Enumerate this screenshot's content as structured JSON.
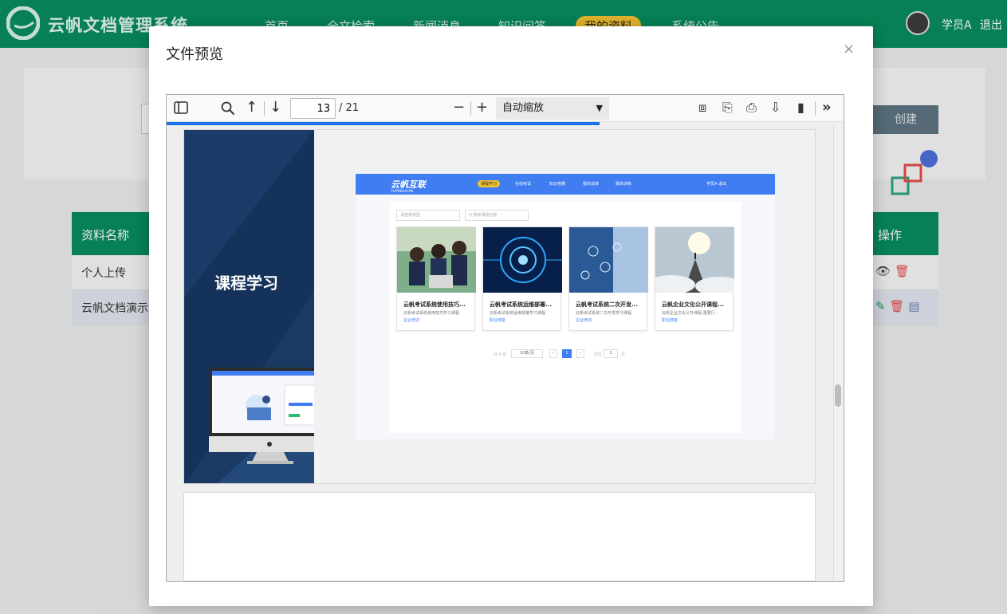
{
  "app": {
    "title": "云帆文档管理系统",
    "nav": [
      "首页",
      "全文检索",
      "新闻消息",
      "知识问答",
      "我的资料",
      "系统公告"
    ],
    "active_nav": "我的资料",
    "user": "学员A",
    "logout": "退出"
  },
  "background": {
    "create_button": "创建",
    "table": {
      "header_name": "资料名称",
      "header_ops": "操作",
      "rows": [
        {
          "name": "个人上传",
          "ops": [
            "eye-icon",
            "trash-icon"
          ]
        },
        {
          "name": "云帆文档演示",
          "ops": [
            "edit-icon",
            "trash-icon",
            "document-icon"
          ]
        }
      ]
    }
  },
  "modal": {
    "title": "文件预览",
    "close": "×",
    "viewer": {
      "current_page": "13",
      "total_pages": "/ 21",
      "zoom": "自动缩放",
      "progress_fraction": 0.64,
      "page": {
        "section_title": "课程学习",
        "screen": {
          "logo": "云帆互联",
          "logo_sub": "YUFANHULIAN",
          "nav": [
            "课程学习",
            "在线考试",
            "知识竞赛",
            "我的成绩",
            "题库训练"
          ],
          "user": "学员A  退出",
          "filter_type": "请选择类型",
          "search_placeholder": "Q 搜索课程名称",
          "cards": [
            {
              "title": "云帆考试系统使用技巧...",
              "desc": "云帆考试系统使用技巧学习课程",
              "tag": "企业培训"
            },
            {
              "title": "云帆考试系统运维部署...",
              "desc": "云帆考试系统运维部署学习课程",
              "tag": "职业技能"
            },
            {
              "title": "云帆考试系统二次开发...",
              "desc": "云帆考试系统二次开发学习课程",
              "tag": "企业培训"
            },
            {
              "title": "云帆企业文化公开课程...",
              "desc": "云帆企业文化公开课程-重要行...",
              "tag": "职业技能"
            }
          ],
          "pager": {
            "total": "共 4 条",
            "per_page": "10条/页",
            "current": "1",
            "goto_label": "前往",
            "goto_value": "1",
            "page_unit": "页"
          }
        }
      }
    }
  }
}
